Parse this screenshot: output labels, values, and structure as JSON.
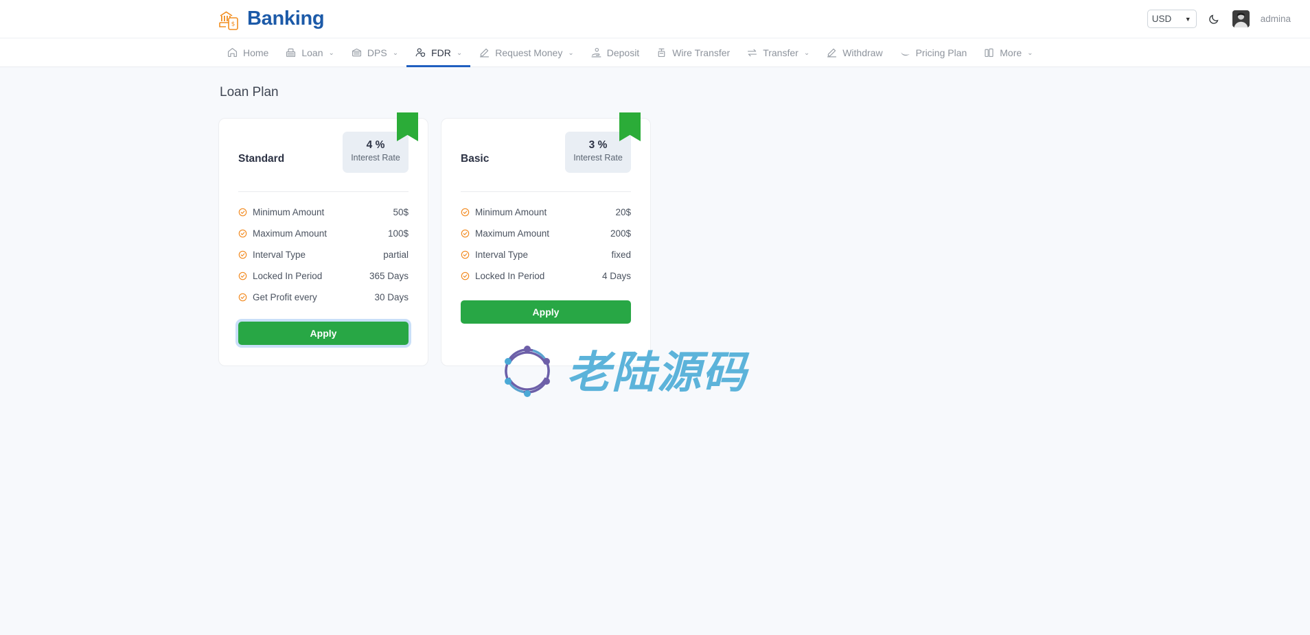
{
  "header": {
    "brand_name": "Banking",
    "brand_icon": "bank-mobile-icon",
    "currency": {
      "selected": "USD",
      "options": [
        "USD"
      ]
    },
    "theme_toggle_icon": "moon-icon",
    "avatar_icon": "user-avatar",
    "username": "admina"
  },
  "nav": {
    "items": [
      {
        "label": "Home",
        "icon": "home-icon",
        "caret": false,
        "active": false
      },
      {
        "label": "Loan",
        "icon": "cash-register-icon",
        "caret": true,
        "active": false
      },
      {
        "label": "DPS",
        "icon": "bank-icon",
        "caret": true,
        "active": false
      },
      {
        "label": "FDR",
        "icon": "user-shield-icon",
        "caret": true,
        "active": true
      },
      {
        "label": "Request Money",
        "icon": "signature-icon",
        "caret": true,
        "active": false
      },
      {
        "label": "Deposit",
        "icon": "hand-coin-icon",
        "caret": false,
        "active": false
      },
      {
        "label": "Wire Transfer",
        "icon": "atm-icon",
        "caret": false,
        "active": false
      },
      {
        "label": "Transfer",
        "icon": "exchange-icon",
        "caret": true,
        "active": false
      },
      {
        "label": "Withdraw",
        "icon": "signature-icon",
        "caret": false,
        "active": false
      },
      {
        "label": "Pricing Plan",
        "icon": "swoosh-icon",
        "caret": false,
        "active": false
      },
      {
        "label": "More",
        "icon": "briefcase-icon",
        "caret": true,
        "active": false
      }
    ]
  },
  "main": {
    "page_title": "Loan Plan",
    "ribbon_color": "#2bac38",
    "accent_check_color": "#f2891e",
    "apply_button_color": "#28a745",
    "plans": [
      {
        "name": "Standard",
        "rate_value": "4 %",
        "rate_label": "Interest Rate",
        "features": [
          {
            "label": "Minimum Amount",
            "value": "50$"
          },
          {
            "label": "Maximum Amount",
            "value": "100$"
          },
          {
            "label": "Interval Type",
            "value": "partial"
          },
          {
            "label": "Locked In Period",
            "value": "365 Days"
          },
          {
            "label": "Get Profit every",
            "value": "30 Days"
          }
        ],
        "apply_label": "Apply",
        "focused": true
      },
      {
        "name": "Basic",
        "rate_value": "3 %",
        "rate_label": "Interest Rate",
        "features": [
          {
            "label": "Minimum Amount",
            "value": "20$"
          },
          {
            "label": "Maximum Amount",
            "value": "200$"
          },
          {
            "label": "Interval Type",
            "value": "fixed"
          },
          {
            "label": "Locked In Period",
            "value": "4 Days"
          }
        ],
        "apply_label": "Apply",
        "focused": false
      }
    ]
  },
  "watermark": {
    "text": "老陆源码",
    "logo_icon": "atom-circle-logo",
    "color": "#5cb3da"
  }
}
